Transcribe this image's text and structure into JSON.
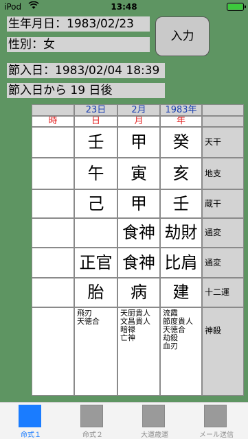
{
  "status": {
    "carrier": "iPod",
    "time": "13:48"
  },
  "form": {
    "birth": "生年月日：1983/02/23",
    "gender": "性別：女",
    "input_button": "入力",
    "setsuiri": "節入日：1983/02/04 18:39",
    "setsuiri_after": "節入日から 19 日後"
  },
  "chart": {
    "dates": {
      "day": "23日",
      "month": "2月",
      "year": "1983年"
    },
    "pillars": {
      "hour": "時",
      "day": "日",
      "month": "月",
      "year": "年"
    },
    "stems": {
      "hour": "",
      "day": "壬",
      "month": "甲",
      "year": "癸",
      "label": "天干"
    },
    "branches": {
      "hour": "",
      "day": "午",
      "month": "寅",
      "year": "亥",
      "label": "地支"
    },
    "hidden": {
      "hour": "",
      "day": "己",
      "month": "甲",
      "year": "壬",
      "label": "蔵干"
    },
    "tsuhen1": {
      "hour": "",
      "day": "",
      "month": "食神",
      "year": "劫財",
      "label": "通変"
    },
    "tsuhen2": {
      "hour": "",
      "day": "正官",
      "month": "食神",
      "year": "比肩",
      "label": "通変"
    },
    "twelve": {
      "hour": "",
      "day": "胎",
      "month": "病",
      "year": "建",
      "label": "十二運"
    },
    "shinsatsu": {
      "label": "神殺",
      "day": [
        "飛刃",
        "天徳合"
      ],
      "month": [
        "天厨貴人",
        "文昌貴人",
        "暗禄",
        "亡神"
      ],
      "year": [
        "流霞",
        "節度貴人",
        "天徳合",
        "劫殺",
        "血刃"
      ]
    }
  },
  "tabs": [
    {
      "label": "命式１",
      "active": true
    },
    {
      "label": "命式２",
      "active": false
    },
    {
      "label": "大運歳運",
      "active": false
    },
    {
      "label": "メール送信",
      "active": false
    }
  ]
}
